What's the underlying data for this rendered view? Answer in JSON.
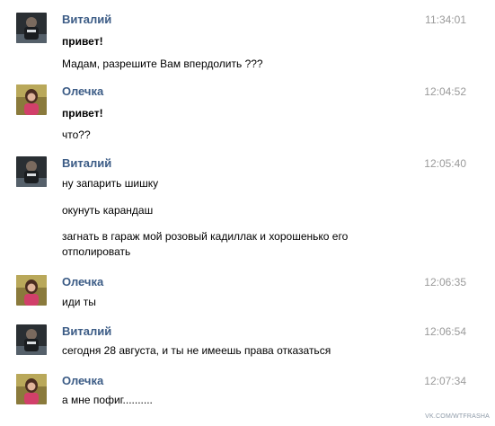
{
  "messages": [
    {
      "author": "Виталий",
      "time": "11:34:01",
      "avatar": "vitaliy-avatar",
      "lines": [
        "привет!",
        "Мадам, разрешите Вам впердолить ???"
      ],
      "bold": [
        true,
        false
      ]
    },
    {
      "author": "Олечка",
      "time": "12:04:52",
      "avatar": "olechka-avatar",
      "lines": [
        "привет!",
        "что??"
      ],
      "bold": [
        true,
        false
      ]
    },
    {
      "author": "Виталий",
      "time": "12:05:40",
      "avatar": "vitaliy-avatar",
      "lines": [
        "ну запарить шишку",
        "окунуть карандаш",
        "загнать в гараж мой розовый кадиллак и хорошенько его отполировать"
      ],
      "bold": [
        false,
        false,
        false
      ]
    },
    {
      "author": "Олечка",
      "time": "12:06:35",
      "avatar": "olechka-avatar",
      "lines": [
        "иди ты"
      ],
      "bold": [
        false
      ]
    },
    {
      "author": "Виталий",
      "time": "12:06:54",
      "avatar": "vitaliy-avatar",
      "lines": [
        "сегодня 28 августа, и ты не имеешь права отказаться"
      ],
      "bold": [
        false
      ]
    },
    {
      "author": "Олечка",
      "time": "12:07:34",
      "avatar": "olechka-avatar",
      "lines": [
        "а мне пофиг.........."
      ],
      "bold": [
        false
      ]
    }
  ],
  "watermark": "VK.COM/WTFRASHA"
}
